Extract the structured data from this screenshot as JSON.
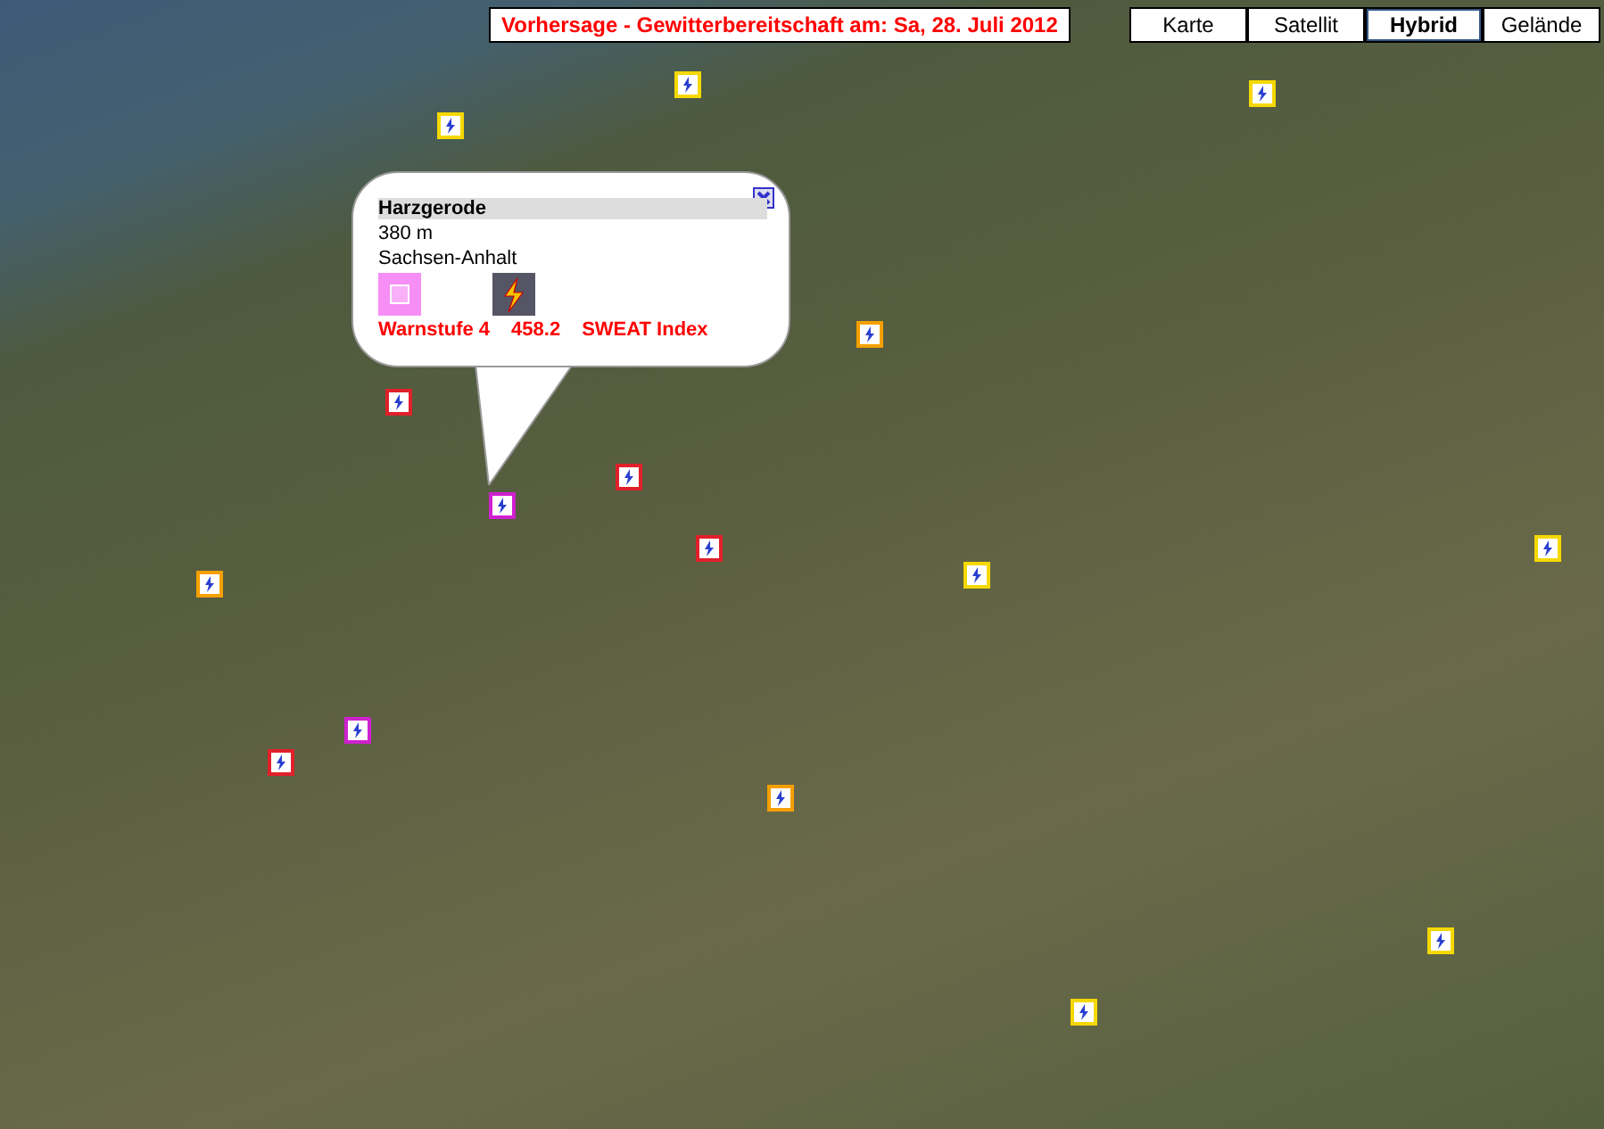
{
  "forecast_title": "Vorhersage - Gewitterbereitschaft am: Sa, 28. Juli 2012",
  "map_types": [
    {
      "label": "Karte",
      "selected": false
    },
    {
      "label": "Satellit",
      "selected": false
    },
    {
      "label": "Hybrid",
      "selected": true
    },
    {
      "label": "Gelände",
      "selected": false
    }
  ],
  "markers": [
    {
      "color": "#f5d800"
    },
    {
      "color": "#f5d800"
    },
    {
      "color": "#e0202a"
    },
    {
      "color": "#e0202a"
    },
    {
      "color": "#f5a000"
    },
    {
      "color": "#f5d800"
    },
    {
      "color": "#d020d0"
    },
    {
      "color": "#e0202a"
    },
    {
      "color": "#f5a000"
    },
    {
      "color": "#f5d800"
    },
    {
      "color": "#f5d800"
    },
    {
      "color": "#d020d0"
    },
    {
      "color": "#f5a000"
    },
    {
      "color": "#e0202a"
    },
    {
      "color": "#f5d800"
    },
    {
      "color": "#f5d800"
    }
  ],
  "popup": {
    "name": "Harzgerode",
    "altitude": "380 m",
    "region": "Sachsen-Anhalt",
    "warning": "Warnstufe 4",
    "sweat_value": "458.2",
    "sweat_label": "SWEAT Index"
  }
}
